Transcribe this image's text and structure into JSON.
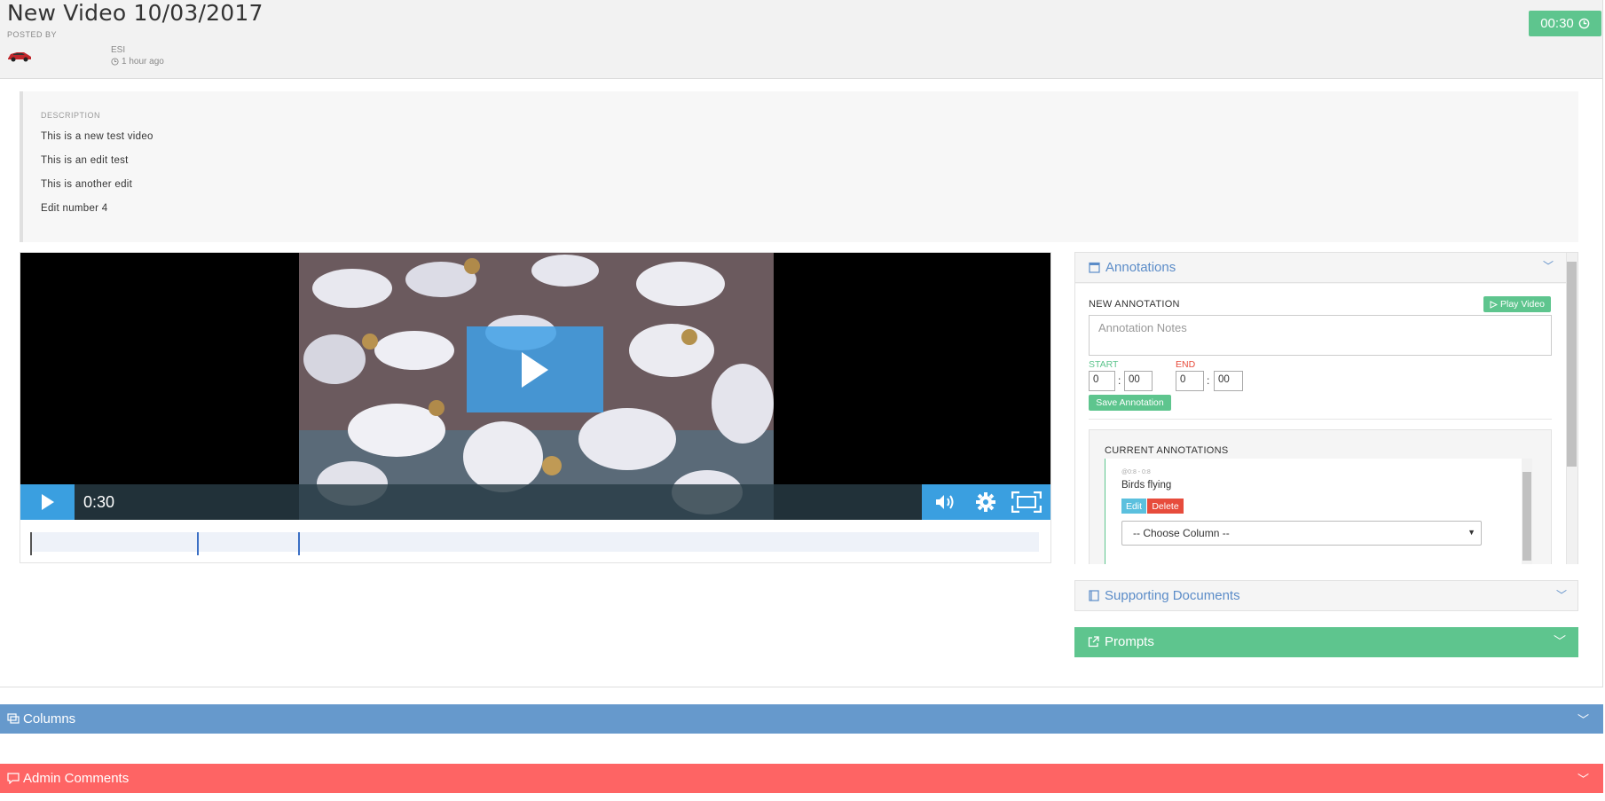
{
  "header": {
    "title": "New Video 10/03/2017",
    "posted_by_label": "POSTED BY",
    "author": "ESI",
    "time_ago": "1 hour ago",
    "timer": "00:30"
  },
  "description": {
    "label": "DESCRIPTION",
    "lines": [
      "This is a new test video",
      "This is an edit test",
      "This is another edit",
      "Edit number 4"
    ]
  },
  "video": {
    "current_time": "0:30"
  },
  "annotations": {
    "title": "Annotations",
    "new_label": "NEW ANNOTATION",
    "play_video_label": "Play Video",
    "notes_placeholder": "Annotation Notes",
    "start_label": "START",
    "end_label": "END",
    "start_min": "0",
    "start_sec": "00",
    "end_min": "0",
    "end_sec": "00",
    "save_label": "Save Annotation",
    "current_label": "CURRENT ANNOTATIONS",
    "items": [
      {
        "range": "@0:8 - 0:8",
        "text": "Birds flying",
        "edit_label": "Edit",
        "delete_label": "Delete",
        "column_select": "-- Choose Column --"
      }
    ]
  },
  "supporting_documents": {
    "title": "Supporting Documents"
  },
  "prompts": {
    "title": "Prompts"
  },
  "columns": {
    "title": "Columns"
  },
  "admin_comments": {
    "title": "Admin Comments"
  },
  "colors": {
    "accent_green": "#5ec58e",
    "accent_blue": "#6699cc",
    "accent_red": "#fe6464",
    "player_blue": "#3a9fe0"
  }
}
